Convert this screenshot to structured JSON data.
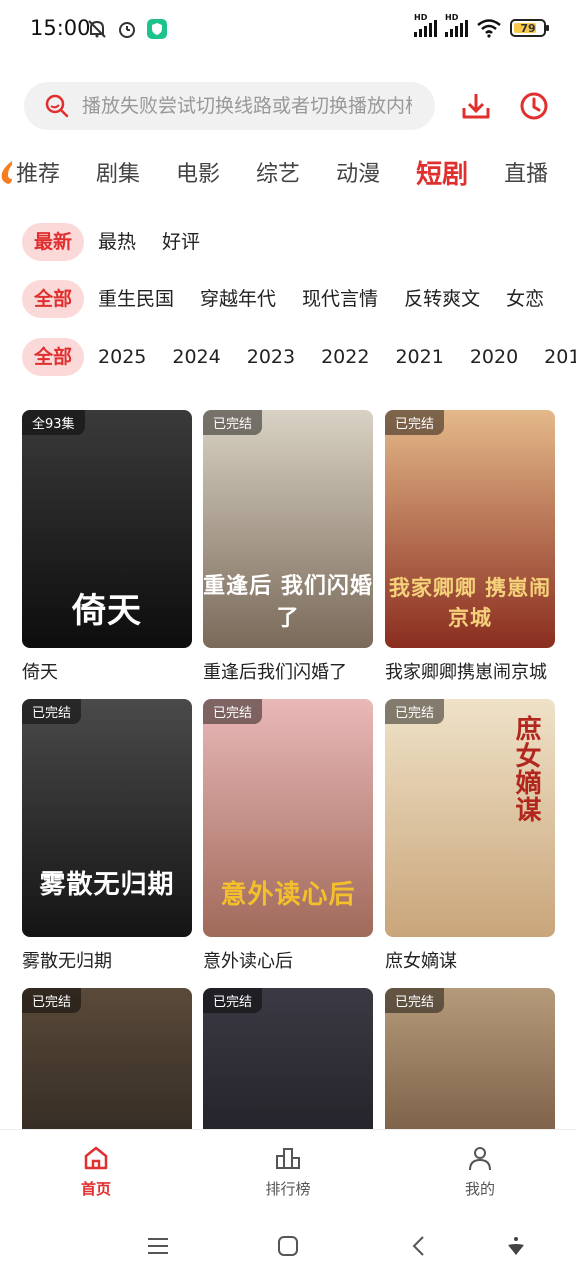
{
  "status": {
    "time": "15:00",
    "sig1_label": "HD",
    "sig2_label": "HD",
    "battery": "79"
  },
  "search": {
    "placeholder": "播放失败尝试切换线路或者切换播放内核"
  },
  "categories": [
    "推荐",
    "剧集",
    "电影",
    "综艺",
    "动漫",
    "短剧",
    "直播"
  ],
  "active_category": "短剧",
  "filters": {
    "sort": [
      "最新",
      "最热",
      "好评"
    ],
    "genre": [
      "全部",
      "重生民国",
      "穿越年代",
      "现代言情",
      "反转爽文",
      "女恋"
    ],
    "year": [
      "全部",
      "2025",
      "2024",
      "2023",
      "2022",
      "2021",
      "2020",
      "201"
    ]
  },
  "cards": [
    {
      "title": "倚天",
      "badge": "全93集",
      "art": "倚天",
      "colors": [
        "#3a3a3a",
        "#0d0d0d"
      ],
      "art_color": "#ffffff"
    },
    {
      "title": "重逢后我们闪婚了",
      "badge": "已完结",
      "art": "重逢后 我们闪婚了",
      "colors": [
        "#d9d2c4",
        "#7a6a5a"
      ],
      "art_color": "#ffffff"
    },
    {
      "title": "我家卿卿携崽闹京城",
      "badge": "已完结",
      "art": "我家卿卿 携崽闹京城",
      "colors": [
        "#e4b98a",
        "#8a2d1f"
      ],
      "art_color": "#f5d27a"
    },
    {
      "title": "雾散无归期",
      "badge": "已完结",
      "art": "雾散无归期",
      "colors": [
        "#4a4a4a",
        "#141414"
      ],
      "art_color": "#ffffff"
    },
    {
      "title": "意外读心后",
      "badge": "已完结",
      "art": "意外读心后",
      "colors": [
        "#e9b8b8",
        "#a06a5a"
      ],
      "art_color": "#f3c02c"
    },
    {
      "title": "庶女嫡谋",
      "badge": "已完结",
      "art": "庶女嫡谋",
      "colors": [
        "#efe2c8",
        "#c9a57a"
      ],
      "art_color": "#b3261e"
    },
    {
      "title": "",
      "badge": "已完结",
      "art": "",
      "colors": [
        "#5a4a3a",
        "#1e1a16"
      ],
      "art_color": "#ffffff"
    },
    {
      "title": "",
      "badge": "已完结",
      "art": "",
      "colors": [
        "#3b3a44",
        "#16151a"
      ],
      "art_color": "#ffffff"
    },
    {
      "title": "",
      "badge": "已完结",
      "art": "",
      "colors": [
        "#b59a7a",
        "#5a3e2a"
      ],
      "art_color": "#ffffff"
    }
  ],
  "bottom_nav": [
    {
      "label": "首页",
      "icon": "home-icon",
      "active": true
    },
    {
      "label": "排行榜",
      "icon": "ranking-icon",
      "active": false
    },
    {
      "label": "我的",
      "icon": "profile-icon",
      "active": false
    }
  ],
  "colors": {
    "accent": "#e02f2f",
    "chip_active_bg": "#fbd9d9"
  }
}
